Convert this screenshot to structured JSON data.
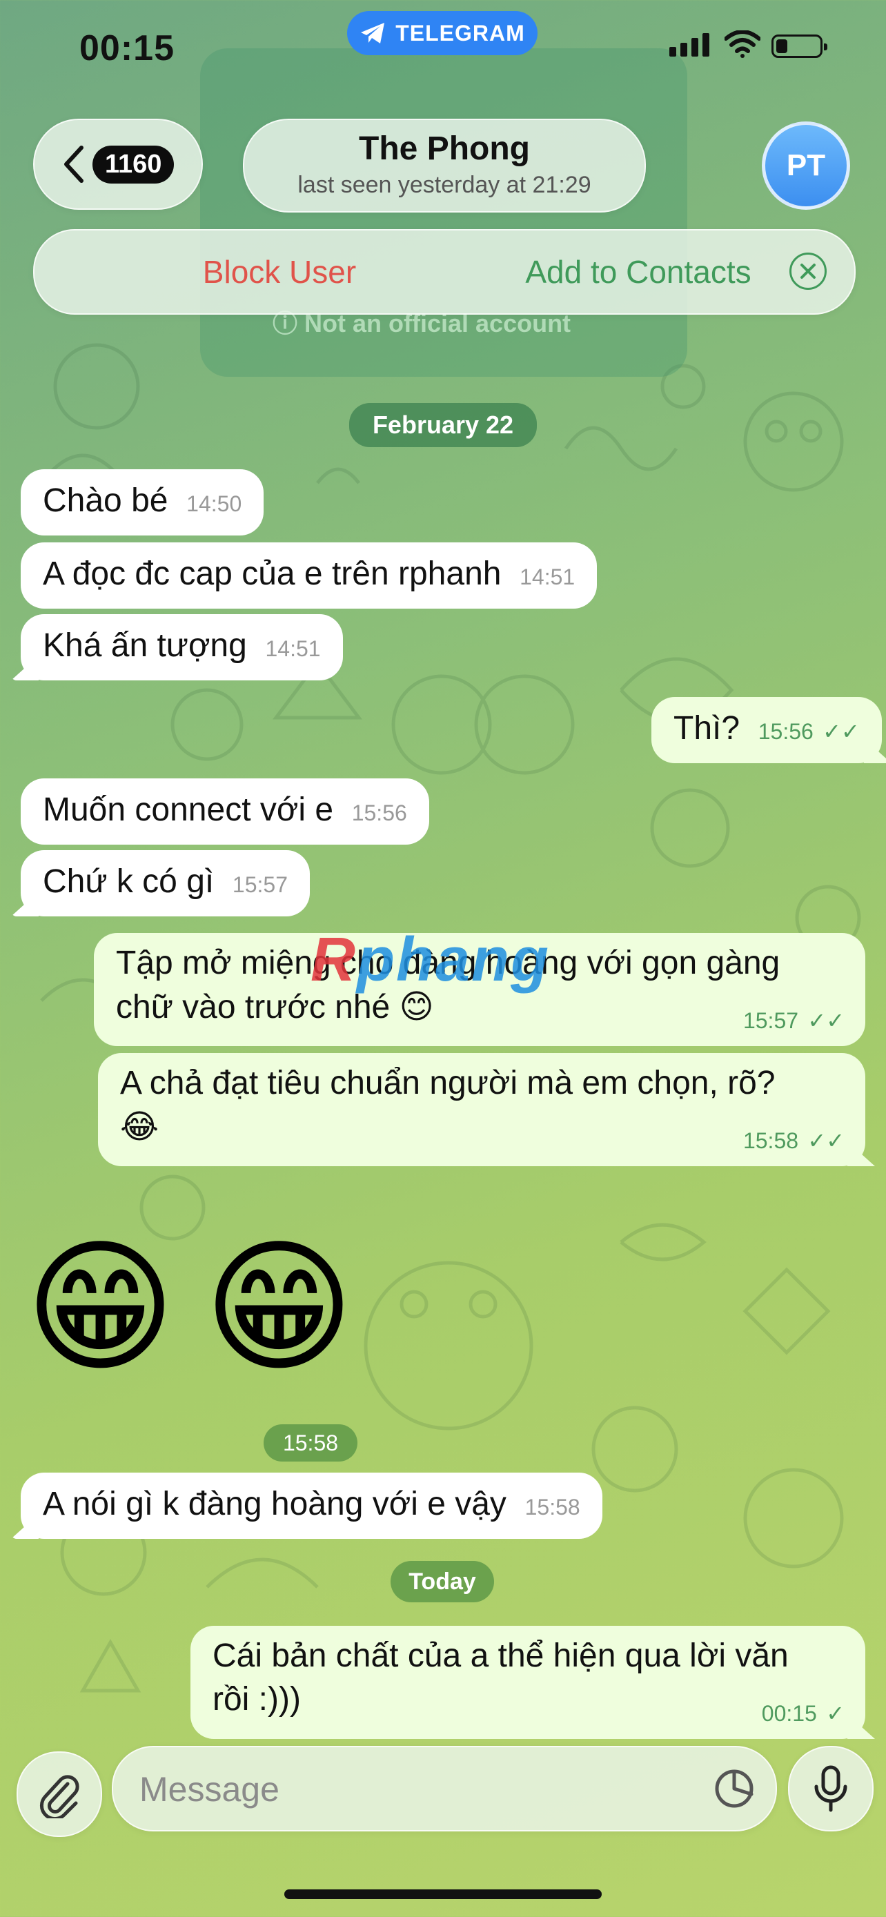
{
  "status_bar": {
    "time": "00:15",
    "app_pill": "TELEGRAM"
  },
  "header": {
    "back_count": "1160",
    "name": "The Phong",
    "subtitle": "last seen yesterday at 21:29",
    "avatar_initials": "PT"
  },
  "action_bar": {
    "block": "Block User",
    "add": "Add to Contacts"
  },
  "background_card": {
    "title": "The Phong",
    "warning": "Not an official account"
  },
  "watermark": {
    "r": "R",
    "rest": "phang"
  },
  "dates": {
    "first": "February 22",
    "today": "Today"
  },
  "messages": [
    {
      "dir": "in",
      "text": "Chào bé",
      "time": "14:50"
    },
    {
      "dir": "in",
      "text": "A đọc đc cap của e trên rphanh",
      "time": "14:51"
    },
    {
      "dir": "in",
      "text": "Khá ấn tượng",
      "time": "14:51"
    },
    {
      "dir": "out",
      "text": "Thì?",
      "time": "15:56"
    },
    {
      "dir": "in",
      "text": "Muốn connect với e",
      "time": "15:56"
    },
    {
      "dir": "in",
      "text": "Chứ k có gì",
      "time": "15:57"
    },
    {
      "dir": "out",
      "text": "Tập mở miệng cho đàng hoàng với gọn gàng chữ vào trước nhé 😊",
      "line1": "Tập mở miệng cho đàng hoàng với gọn gàng",
      "line2": "chữ vào trước nhé 😊",
      "time": "15:57"
    },
    {
      "dir": "out",
      "text": "A chả đạt tiêu chuẩn người mà em chọn, rõ? 😂",
      "line1": "A chả đạt tiêu chuẩn người mà em chọn, rõ?",
      "line2": "😂",
      "time": "15:58"
    },
    {
      "dir": "in",
      "text": "😁😁",
      "emoji1": "😁",
      "emoji2": "😁",
      "time": "15:58"
    },
    {
      "dir": "in",
      "text": "A nói gì k đàng hoàng với e vậy",
      "time": "15:58"
    },
    {
      "dir": "out",
      "text": "Cái bản chất của a thể hiện qua lời văn rồi :)))",
      "line1": "Cái bản chất của a thể hiện qua lời văn",
      "line2": "rồi :)))",
      "time": "00:15"
    }
  ],
  "input": {
    "placeholder": "Message"
  },
  "colors": {
    "accent_blue": "#2f84f4",
    "block_red": "#e0534a",
    "add_green": "#3f9a5a",
    "bubble_out": "#effedd",
    "bubble_in": "#ffffff"
  }
}
